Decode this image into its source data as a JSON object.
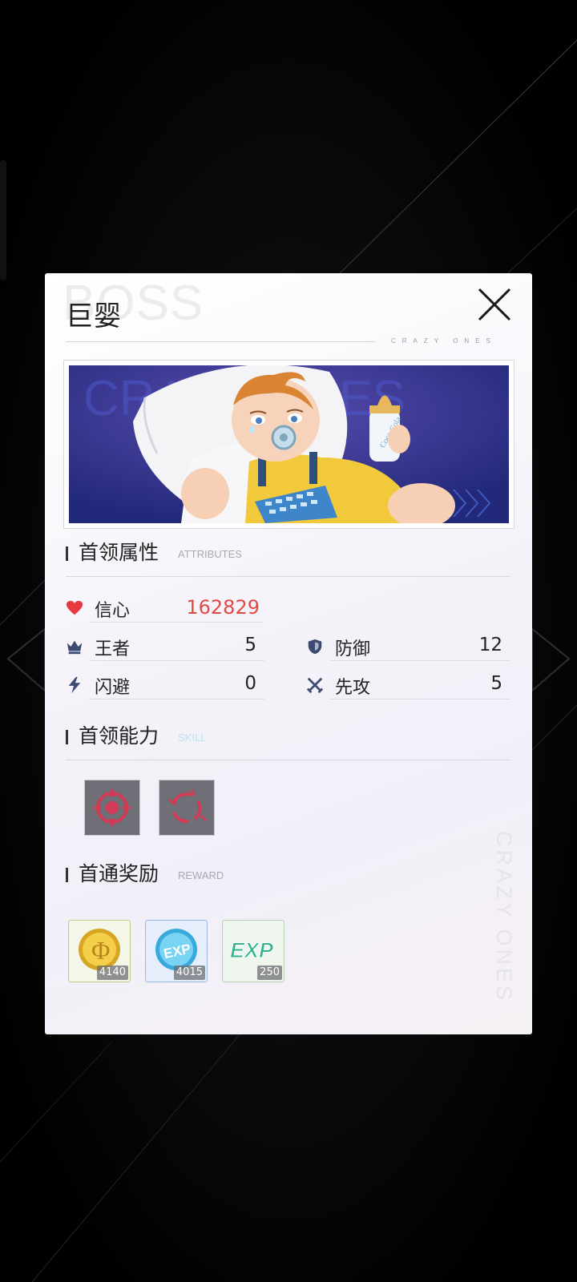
{
  "title": {
    "cn": "巨婴",
    "watermark": "BOSS",
    "brand_small": "CRAZY ONES",
    "brand_vertical": "CRAZY ONES"
  },
  "banner": {
    "watermark": "CRAZY ONES",
    "bottle_text": "Coca-Cola"
  },
  "attributes": {
    "heading_cn": "首领属性",
    "heading_en": "ATTRIBUTES",
    "hp": {
      "icon": "heart-icon",
      "label": "信心",
      "value": "162829",
      "color": "#e04a44"
    },
    "stats": [
      {
        "icon": "crown-icon",
        "label": "王者",
        "value": "5"
      },
      {
        "icon": "shield-icon",
        "label": "防御",
        "value": "12"
      },
      {
        "icon": "lightning-icon",
        "label": "闪避",
        "value": "0"
      },
      {
        "icon": "crossed-swords-icon",
        "label": "先攻",
        "value": "5"
      }
    ]
  },
  "skills": {
    "heading_cn": "首领能力",
    "heading_en": "SKILL",
    "items": [
      {
        "icon": "target-crosshair-icon"
      },
      {
        "icon": "broken-ring-icon"
      }
    ]
  },
  "rewards": {
    "heading_cn": "首通奖励",
    "heading_en": "REWARD",
    "items": [
      {
        "icon": "gold-coin-icon",
        "count": "4140"
      },
      {
        "icon": "exp-coin-icon",
        "count": "4015"
      },
      {
        "icon": "exp-text-icon",
        "count": "250"
      }
    ]
  },
  "colors": {
    "accent_red": "#e04a44",
    "skill_red": "#d23a55",
    "exp_green": "#2fb38a"
  }
}
